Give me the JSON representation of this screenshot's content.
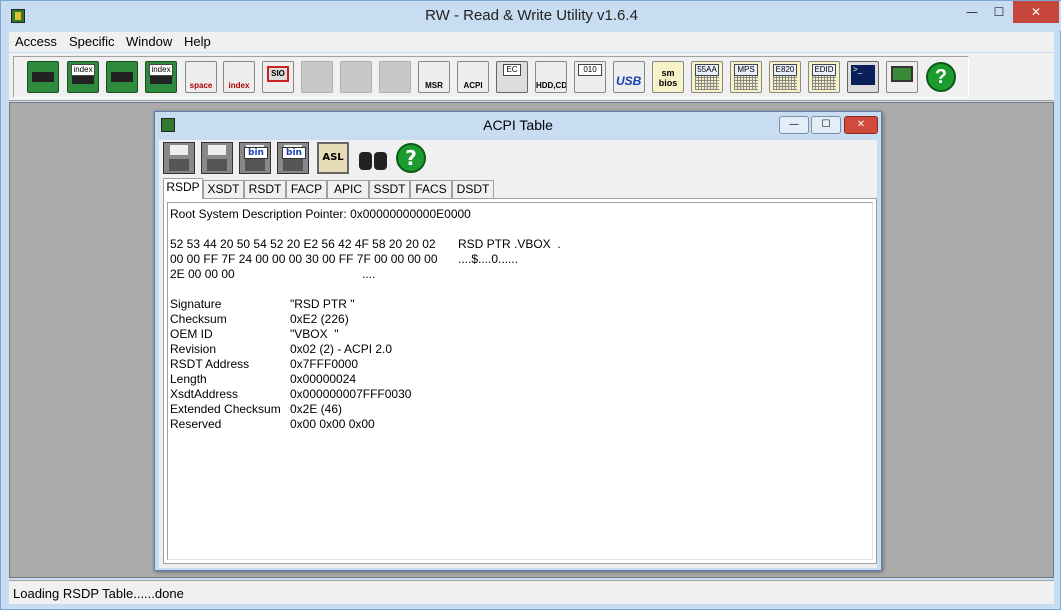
{
  "app": {
    "title": "RW - Read & Write Utility v1.6.4",
    "window_controls": {
      "minimize": "—",
      "maximize": "☐",
      "close": "✕"
    }
  },
  "menu": [
    "Access",
    "Specific",
    "Window",
    "Help"
  ],
  "toolbar": {
    "icons": [
      {
        "name": "pci-board-icon",
        "label": ""
      },
      {
        "name": "pci-index-icon",
        "label": "index"
      },
      {
        "name": "memory-board-icon",
        "label": ""
      },
      {
        "name": "memory-index-icon",
        "label": "index"
      },
      {
        "name": "io-space-icon",
        "label": "space"
      },
      {
        "name": "io-index-icon",
        "label": "index"
      },
      {
        "name": "superio-icon",
        "label": "SIO"
      },
      {
        "name": "disabled-icon-1",
        "label": ""
      },
      {
        "name": "disabled-icon-2",
        "label": ""
      },
      {
        "name": "disabled-icon-3",
        "label": ""
      },
      {
        "name": "msr-icon",
        "label": "MSR"
      },
      {
        "name": "acpi-icon",
        "label": "ACPI"
      },
      {
        "name": "ec-icon",
        "label": "EC"
      },
      {
        "name": "hdd-cd-icon",
        "label": "HDD,CD"
      },
      {
        "name": "spd-icon",
        "label": "010"
      },
      {
        "name": "usb-icon",
        "label": "USB"
      },
      {
        "name": "smbios-icon",
        "label": "sm bios"
      },
      {
        "name": "55aa-icon",
        "label": "55AA"
      },
      {
        "name": "mps-icon",
        "label": "MPS"
      },
      {
        "name": "e820-icon",
        "label": "E820"
      },
      {
        "name": "edid-icon",
        "label": "EDID"
      },
      {
        "name": "command-icon",
        "label": ">_"
      },
      {
        "name": "battery-icon",
        "label": ""
      },
      {
        "name": "help-icon",
        "label": "?"
      }
    ]
  },
  "acpi_window": {
    "title": "ACPI Table",
    "controls": {
      "minimize": "—",
      "maximize": "☐",
      "close": "✕"
    },
    "tools": [
      {
        "name": "save-icon",
        "label": ""
      },
      {
        "name": "save-all-icon",
        "label": ""
      },
      {
        "name": "save-bin-icon",
        "label": "bin"
      },
      {
        "name": "save-all-bin-icon",
        "label": "bin"
      },
      {
        "name": "asl-icon",
        "label": "ASL"
      },
      {
        "name": "find-icon",
        "label": ""
      },
      {
        "name": "help-icon",
        "label": "?"
      }
    ],
    "tabs": [
      "RSDP",
      "XSDT",
      "RSDT",
      "FACP",
      "APIC",
      "SSDT",
      "FACS",
      "DSDT"
    ],
    "active_tab": "RSDP",
    "header_line": "Root System Description Pointer: 0x00000000000E0000",
    "hex_rows": [
      {
        "hex": "52 53 44 20 50 54 52 20 E2 56 42 4F 58 20 20 02",
        "ascii": "RSD PTR .VBOX  ."
      },
      {
        "hex": "00 00 FF 7F 24 00 00 00 30 00 FF 7F 00 00 00 00",
        "ascii": "....$....0......"
      },
      {
        "hex": "2E 00 00 00",
        "ascii": "...."
      }
    ],
    "fields": [
      {
        "key": "Signature",
        "value": "\"RSD PTR \""
      },
      {
        "key": "Checksum",
        "value": "0xE2 (226)"
      },
      {
        "key": "OEM ID",
        "value": "\"VBOX  \""
      },
      {
        "key": "Revision",
        "value": "0x02 (2) - ACPI 2.0"
      },
      {
        "key": "RSDT Address",
        "value": "0x7FFF0000"
      },
      {
        "key": "Length",
        "value": "0x00000024"
      },
      {
        "key": "XsdtAddress",
        "value": "0x000000007FFF0030"
      },
      {
        "key": "Extended Checksum",
        "value": "0x2E (46)"
      },
      {
        "key": "Reserved",
        "value": "0x00 0x00 0x00"
      }
    ]
  },
  "status": {
    "text": "Loading RSDP Table......done"
  }
}
